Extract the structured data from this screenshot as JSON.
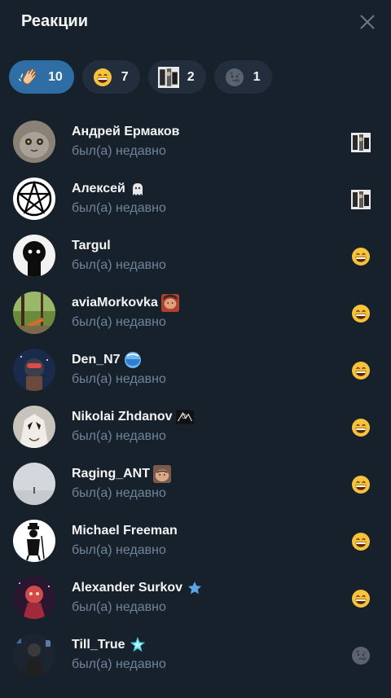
{
  "header": {
    "title": "Реакции"
  },
  "tabs": [
    {
      "emoji": "clapping-hands-icon",
      "count": "10"
    },
    {
      "emoji": "grinning-face-icon",
      "count": "7"
    },
    {
      "emoji": "custom-photo-sticker-icon",
      "count": "2"
    },
    {
      "emoji": "new-moon-face-icon",
      "count": "1"
    }
  ],
  "users": [
    {
      "name": "Андрей Ермаков",
      "status": "был(а) недавно",
      "reaction": "custom-photo-sticker-icon"
    },
    {
      "name": "Алексей",
      "status": "был(а) недавно",
      "reaction": "custom-photo-sticker-icon"
    },
    {
      "name": "Targul",
      "status": "был(а) недавно",
      "reaction": "grinning-face-icon"
    },
    {
      "name": "aviaMorkovka",
      "status": "был(а) недавно",
      "reaction": "grinning-face-icon"
    },
    {
      "name": "Den_N7",
      "status": "был(а) недавно",
      "reaction": "grinning-face-icon"
    },
    {
      "name": "Nikolai Zhdanov",
      "status": "был(а) недавно",
      "reaction": "grinning-face-icon"
    },
    {
      "name": "Raging_ANT",
      "status": "был(а) недавно",
      "reaction": "grinning-face-icon"
    },
    {
      "name": "Michael Freeman",
      "status": "был(а) недавно",
      "reaction": "grinning-face-icon"
    },
    {
      "name": "Alexander Surkov",
      "status": "был(а) недавно",
      "reaction": "grinning-face-icon"
    },
    {
      "name": "Till_True",
      "status": "был(а) недавно",
      "reaction": "new-moon-face-icon"
    }
  ],
  "colors": {
    "background": "#17212b",
    "tab_bg": "#232e3c",
    "tab_active": "#2f6ea5",
    "status_text": "#708499"
  }
}
